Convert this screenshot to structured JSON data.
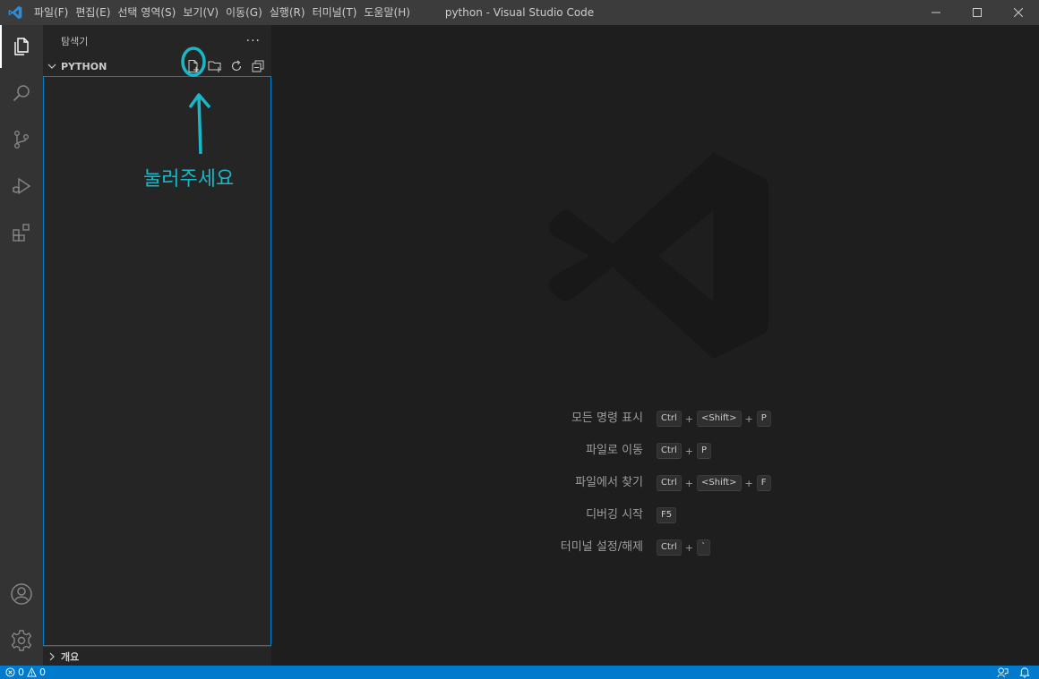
{
  "titlebar": {
    "menu": [
      "파일(F)",
      "편집(E)",
      "선택 영역(S)",
      "보기(V)",
      "이동(G)",
      "실행(R)",
      "터미널(T)",
      "도움말(H)"
    ],
    "title": "python - Visual Studio Code"
  },
  "sidebar": {
    "title": "탐색기",
    "more": "···",
    "section_title": "PYTHON",
    "outline_title": "개요"
  },
  "annotation": {
    "label": "눌러주세요",
    "color": "#19b8c8"
  },
  "editor": {
    "shortcuts": [
      {
        "label": "모든 명령 표시",
        "keys": [
          "Ctrl",
          "<Shift>",
          "P"
        ]
      },
      {
        "label": "파일로 이동",
        "keys": [
          "Ctrl",
          "P"
        ]
      },
      {
        "label": "파일에서 찾기",
        "keys": [
          "Ctrl",
          "<Shift>",
          "F"
        ]
      },
      {
        "label": "디버깅 시작",
        "keys": [
          "F5"
        ]
      },
      {
        "label": "터미널 설정/해제",
        "keys": [
          "Ctrl",
          "`"
        ]
      }
    ]
  },
  "statusbar": {
    "errors": "0",
    "warnings": "0"
  },
  "icons": {
    "activity": [
      "files-icon",
      "search-icon",
      "source-control-icon",
      "run-debug-icon",
      "extensions-icon",
      "account-icon",
      "gear-icon"
    ],
    "section_actions": [
      "new-file-icon",
      "new-folder-icon",
      "refresh-icon",
      "collapse-all-icon"
    ]
  },
  "colors": {
    "accent": "#007acc",
    "focus_border": "#007fd4",
    "titlebar": "#3c3c3c",
    "activitybar": "#333333",
    "sidebar": "#252526",
    "editor": "#1e1e1e"
  }
}
